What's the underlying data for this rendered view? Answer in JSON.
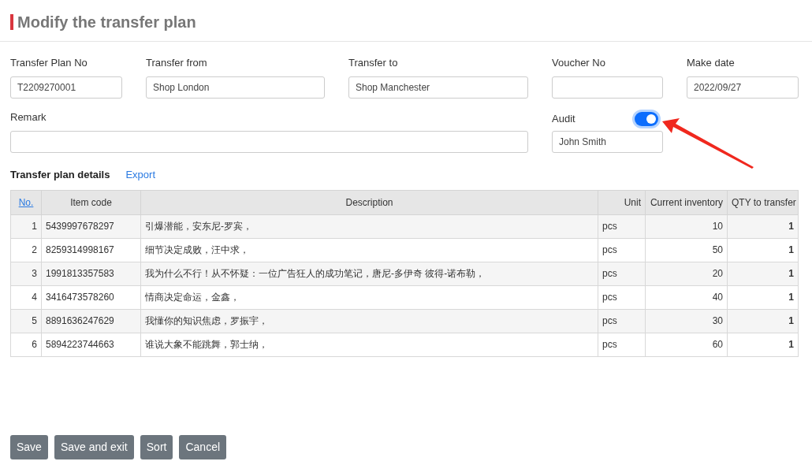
{
  "title": "Modify the transfer plan",
  "fields_row1": [
    {
      "label": "Transfer Plan No",
      "value": "T2209270001"
    },
    {
      "label": "Transfer from",
      "value": "Shop London"
    },
    {
      "label": "Transfer to",
      "value": "Shop Manchester"
    },
    {
      "label": "Voucher No"
    },
    {
      "label": "Make date",
      "value": "2022/09/27"
    }
  ],
  "remark": {
    "label": "Remark"
  },
  "audit": {
    "label": "Audit",
    "on": true,
    "value": "John Smith"
  },
  "details": {
    "title": "Transfer plan details",
    "export": "Export"
  },
  "table": {
    "columns": [
      "No.",
      "Item code",
      "Description",
      "Unit",
      "Current inventory",
      "QTY to transfer"
    ],
    "rows": [
      [
        "1",
        "5439997678297",
        "引爆潜能，安东尼-罗宾，",
        "pcs",
        "10",
        "1"
      ],
      [
        "2",
        "8259314998167",
        "细节决定成败，汪中求，",
        "pcs",
        "50",
        "1"
      ],
      [
        "3",
        "1991813357583",
        "我为什么不行！从不怀疑：一位广告狂人的成功笔记，唐尼-多伊奇 彼得-诺布勒，",
        "pcs",
        "20",
        "1"
      ],
      [
        "4",
        "3416473578260",
        "情商决定命运，金鑫，",
        "pcs",
        "40",
        "1"
      ],
      [
        "5",
        "8891636247629",
        "我懂你的知识焦虑，罗振宇，",
        "pcs",
        "30",
        "1"
      ],
      [
        "6",
        "5894223744663",
        "谁说大象不能跳舞，郭士纳，",
        "pcs",
        "60",
        "1"
      ]
    ]
  },
  "buttons": [
    "Save",
    "Save and exit",
    "Sort",
    "Cancel"
  ]
}
